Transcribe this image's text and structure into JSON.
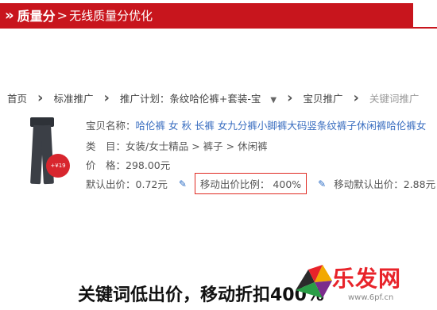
{
  "banner": {
    "icon": "double-chevron-right-icon",
    "title": "质量分",
    "separator": ">",
    "subtitle": "无线质量分优化",
    "color": "#c8151d"
  },
  "breadcrumb": {
    "home": "首页",
    "standard": "标准推广",
    "plan_label": "推广计划：条纹哈伦裤+套装-宝",
    "item_promo": "宝贝推广",
    "keyword_promo": "关键词推广"
  },
  "product": {
    "badge": "+¥19",
    "name_label": "宝贝名称：",
    "name_value": "哈伦裤 女 秋 长裤 女九分裤小脚裤大码竖条纹裤子休闲裤哈伦裤女",
    "category_label": "类　目：",
    "category_value": "女装/女士精品 > 裤子 > 休闲裤",
    "price_label": "价　格：",
    "price_value": "298.00元",
    "default_bid_label": "默认出价：",
    "default_bid_value": "0.72元",
    "mobile_ratio_label": "移动出价比例：",
    "mobile_ratio_value": "400%",
    "mobile_default_label": "移动默认出价：",
    "mobile_default_value": "2.88元",
    "highlight_color": "#e02a22"
  },
  "caption": "关键词低出价，移动折扣400%",
  "watermark": {
    "text": "乐发网",
    "url": "www.6pf.cn"
  }
}
